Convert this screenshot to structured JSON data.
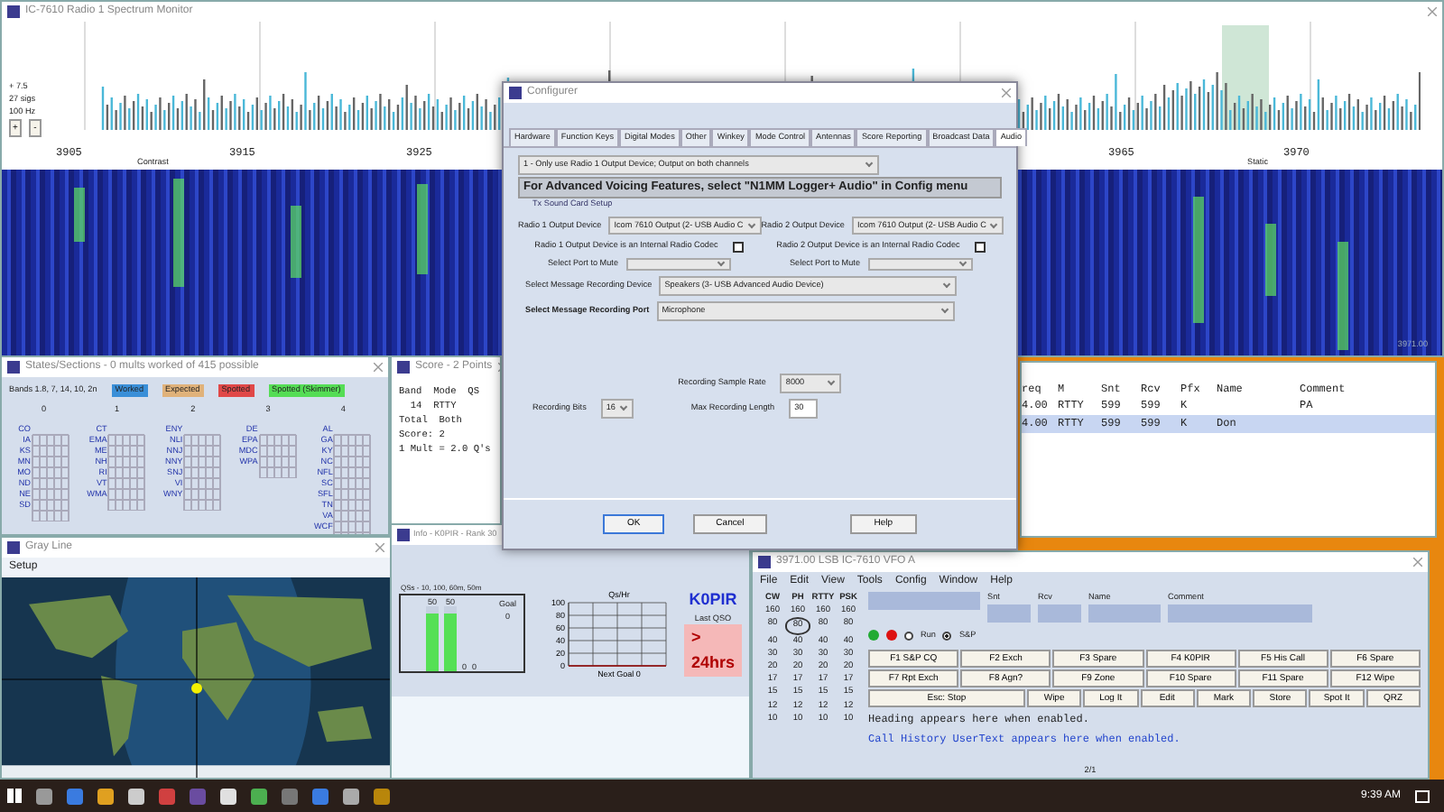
{
  "spectrum_window": {
    "title": "IC-7610 Radio 1 Spectrum Monitor",
    "readouts": [
      "+ 7.5",
      "27 sigs",
      "100 Hz"
    ],
    "zoom_buttons": [
      "+",
      "-"
    ],
    "freq_labels": [
      "3905",
      "3915",
      "3925",
      "3965",
      "3970"
    ],
    "contrast_label": "Contrast",
    "static_label": "Static",
    "waterfall_freq": "3971.00"
  },
  "states_window": {
    "title": "States/Sections - 0 mults worked of 415 possible",
    "bands": "Bands 1.8, 7, 14, 10, 2n",
    "legend": [
      {
        "label": "Worked",
        "color": "#3a8fd8"
      },
      {
        "label": "Expected",
        "color": "#e0b27a"
      },
      {
        "label": "Spotted",
        "color": "#e04848"
      },
      {
        "label": "Spotted (Skimmer)",
        "color": "#55dd55"
      }
    ],
    "columns": [
      {
        "heading": "0",
        "sections": [
          "CO",
          "IA",
          "KS",
          "MN",
          "MO",
          "ND",
          "NE",
          "SD"
        ]
      },
      {
        "heading": "1",
        "sections": [
          "CT",
          "EMA",
          "ME",
          "NH",
          "RI",
          "VT",
          "WMA"
        ]
      },
      {
        "heading": "2",
        "sections": [
          "ENY",
          "NLI",
          "NNJ",
          "NNY",
          "SNJ",
          "VI",
          "WNY"
        ]
      },
      {
        "heading": "3",
        "sections": [
          "DE",
          "EPA",
          "MDC",
          "WPA"
        ]
      },
      {
        "heading": "4",
        "sections": [
          "AL",
          "GA",
          "KY",
          "NC",
          "NFL",
          "SC",
          "SFL",
          "TN",
          "VA",
          "WCF"
        ]
      }
    ]
  },
  "score_window": {
    "title": "Score - 2 Points",
    "lines": [
      "Band  Mode  QS",
      "  14  RTTY",
      "Total  Both",
      "Score: 2",
      "1 Mult = 2.0 Q's"
    ]
  },
  "log_window": {
    "columns": [
      "req",
      "M",
      "Snt",
      "Rcv",
      "Pfx",
      "Name",
      "Comment"
    ],
    "rows": [
      {
        "freq": "4.00",
        "mode": "RTTY",
        "snt": "599",
        "rcv": "599",
        "pfx": "K",
        "comment": "PA",
        "selected": false
      },
      {
        "freq": "4.00",
        "mode": "RTTY",
        "snt": "599",
        "rcv": "599",
        "pfx": "K",
        "name": "Don",
        "selected": true
      }
    ]
  },
  "grayline_window": {
    "title": "Gray Line",
    "menu": [
      "Setup"
    ]
  },
  "info_window": {
    "title": "Info - K0PIR - Rank 30",
    "goal_label": "Goal",
    "goal_value": "0",
    "goal_chart": {
      "title": "QSs - 10, 100, 60m, 50m",
      "bars": [
        {
          "label": "50",
          "level": 0.9
        },
        {
          "label": "50",
          "level": 0.9
        },
        {
          "label": "0"
        },
        {
          "label": "0"
        }
      ]
    },
    "rate_chart": {
      "title": "Qs/Hr",
      "xlabel": "Next Goal 0",
      "tick_labels": [
        "100",
        "80",
        "60",
        "40",
        "20",
        "0"
      ]
    },
    "callsign": "K0PIR",
    "last_qso_label": "Last QSO",
    "last_qso": "> 24hrs"
  },
  "main_window": {
    "title": "3971.00 LSB IC-7610 VFO A",
    "menu": [
      "File",
      "Edit",
      "View",
      "Tools",
      "Config",
      "Window",
      "Help"
    ],
    "band_headers": [
      "CW",
      "PH",
      "RTTY",
      "PSK"
    ],
    "band_rows": [
      {
        "cells": [
          {
            "text": "160",
            "selected": false
          },
          {
            "text": "160",
            "selected": false
          },
          {
            "text": "160",
            "selected": false
          },
          {
            "text": "160",
            "selected": false
          }
        ]
      },
      {
        "cells": [
          {
            "text": "80",
            "selected": false
          },
          {
            "text": "80",
            "selected": true
          },
          {
            "text": "80",
            "selected": false
          },
          {
            "text": "80",
            "selected": false
          }
        ]
      },
      {
        "cells": [
          {
            "text": "40",
            "selected": false
          },
          {
            "text": "40",
            "selected": false
          },
          {
            "text": "40",
            "selected": false
          },
          {
            "text": "40",
            "selected": false
          }
        ]
      },
      {
        "cells": [
          {
            "text": "30",
            "selected": false
          },
          {
            "text": "30",
            "selected": false
          },
          {
            "text": "30",
            "selected": false
          },
          {
            "text": "30",
            "selected": false
          }
        ]
      },
      {
        "cells": [
          {
            "text": "20",
            "selected": false
          },
          {
            "text": "20",
            "selected": false
          },
          {
            "text": "20",
            "selected": false
          },
          {
            "text": "20",
            "selected": false
          }
        ]
      },
      {
        "cells": [
          {
            "text": "17",
            "selected": false
          },
          {
            "text": "17",
            "selected": false
          },
          {
            "text": "17",
            "selected": false
          },
          {
            "text": "17",
            "selected": false
          }
        ]
      },
      {
        "cells": [
          {
            "text": "15",
            "selected": false
          },
          {
            "text": "15",
            "selected": false
          },
          {
            "text": "15",
            "selected": false
          },
          {
            "text": "15",
            "selected": false
          }
        ]
      },
      {
        "cells": [
          {
            "text": "12",
            "selected": false
          },
          {
            "text": "12",
            "selected": false
          },
          {
            "text": "12",
            "selected": false
          },
          {
            "text": "12",
            "selected": false
          }
        ]
      },
      {
        "cells": [
          {
            "text": "10",
            "selected": false
          },
          {
            "text": "10",
            "selected": false
          },
          {
            "text": "10",
            "selected": false
          },
          {
            "text": "10",
            "selected": false
          }
        ]
      }
    ],
    "field_labels": [
      "Snt",
      "Rcv",
      "Name",
      "Comment"
    ],
    "status_dots": [
      {
        "color": "#22aa33"
      },
      {
        "color": "#dd1111"
      }
    ],
    "modes": [
      {
        "label": "Run",
        "selected": false
      },
      {
        "label": "S&P",
        "selected": true
      }
    ],
    "fkeys": [
      "F1 S&P CQ",
      "F2 Exch",
      "F3 Spare",
      "F4 K0PIR",
      "F5 His Call",
      "F6 Spare",
      "F7 Rpt Exch",
      "F8 Agn?",
      "F9 Zone",
      "F10 Spare",
      "F11 Spare",
      "F12 Wipe"
    ],
    "action_keys": [
      "Esc: Stop",
      "Wipe",
      "Log It",
      "Edit",
      "Mark",
      "Store",
      "Spot It",
      "QRZ"
    ],
    "heading_text": "Heading appears here when enabled.",
    "user_text": "Call History UserText appears here when enabled.",
    "status": "2/1"
  },
  "configurer": {
    "title": "Configurer",
    "tabs": [
      {
        "label": "Hardware",
        "selected": false
      },
      {
        "label": "Function Keys",
        "selected": false
      },
      {
        "label": "Digital Modes",
        "selected": false
      },
      {
        "label": "Other",
        "selected": false
      },
      {
        "label": "Winkey",
        "selected": false
      },
      {
        "label": "Mode Control",
        "selected": false
      },
      {
        "label": "Antennas",
        "selected": false
      },
      {
        "label": "Score Reporting",
        "selected": false
      },
      {
        "label": "Broadcast Data",
        "selected": false
      },
      {
        "label": "Audio",
        "selected": true
      }
    ],
    "channel_mode": "1 - Only use Radio 1 Output Device; Output on both channels",
    "banner": "For Advanced Voicing Features, select \"N1MM Logger+ Audio\" in Config menu",
    "setup_link": "Tx Sound Card Setup",
    "radio1_label": "Radio 1 Output Device",
    "radio1_device": "Icom 7610 Output (2- USB Audio C",
    "radio2_label": "Radio 2 Output Device",
    "radio2_device": "Icom 7610 Output (2- USB Audio C",
    "codec_checks": [
      {
        "label": "Radio 1 Output Device is an Internal Radio Codec",
        "checked": false
      },
      {
        "label": "Radio 2 Output Device is an Internal Radio Codec",
        "checked": false
      }
    ],
    "mute_labels": [
      "Select Port to Mute",
      "Select Port to Mute"
    ],
    "rec_device_label": "Select Message Recording Device",
    "rec_device": "Speakers (3- USB Advanced Audio Device)",
    "rec_port_label": "Select Message Recording Port",
    "rec_port": "Microphone",
    "sample_rate_label": "Recording Sample Rate",
    "sample_rate": "8000",
    "bits_label": "Recording Bits",
    "bits": "16",
    "max_len_label": "Max Recording Length",
    "max_len": "30",
    "buttons": [
      "OK",
      "Cancel",
      "Help"
    ]
  },
  "taskbar": {
    "time": "9:39 AM"
  }
}
